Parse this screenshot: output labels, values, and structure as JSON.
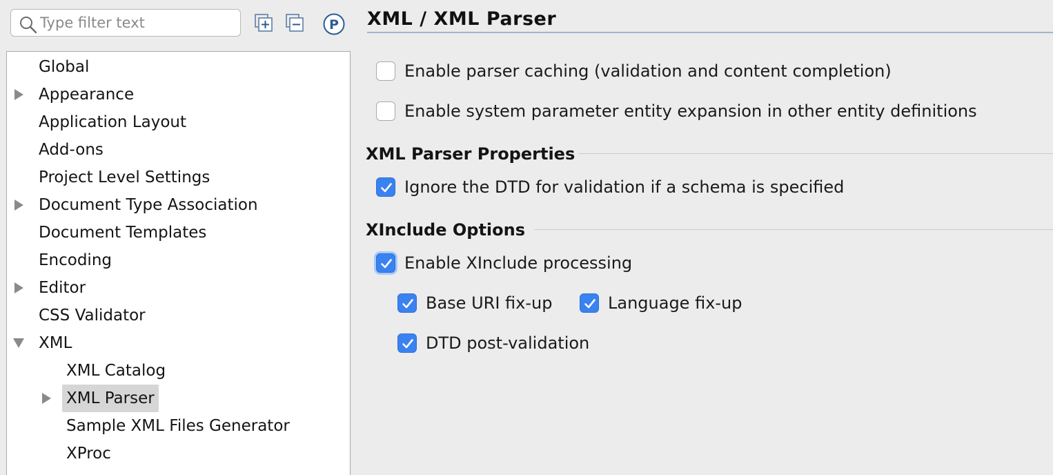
{
  "search": {
    "placeholder": "Type filter text"
  },
  "toolbar": {
    "expand_all_icon": "expand-all-icon",
    "collapse_all_icon": "collapse-all-icon",
    "project_icon": "project-options-icon",
    "project_icon_letter": "P"
  },
  "tree": {
    "items": [
      {
        "label": "Global",
        "level": 0,
        "arrow": ""
      },
      {
        "label": "Appearance",
        "level": 0,
        "arrow": "collapsed"
      },
      {
        "label": "Application Layout",
        "level": 0,
        "arrow": ""
      },
      {
        "label": "Add-ons",
        "level": 0,
        "arrow": ""
      },
      {
        "label": "Project Level Settings",
        "level": 0,
        "arrow": ""
      },
      {
        "label": "Document Type Association",
        "level": 0,
        "arrow": "collapsed"
      },
      {
        "label": "Document Templates",
        "level": 0,
        "arrow": ""
      },
      {
        "label": "Encoding",
        "level": 0,
        "arrow": ""
      },
      {
        "label": "Editor",
        "level": 0,
        "arrow": "collapsed"
      },
      {
        "label": "CSS Validator",
        "level": 0,
        "arrow": ""
      },
      {
        "label": "XML",
        "level": 0,
        "arrow": "expanded"
      },
      {
        "label": "XML Catalog",
        "level": 1,
        "arrow": ""
      },
      {
        "label": "XML Parser",
        "level": 1,
        "arrow": "collapsed",
        "selected": true
      },
      {
        "label": "Sample XML Files Generator",
        "level": 1,
        "arrow": ""
      },
      {
        "label": "XProc",
        "level": 1,
        "arrow": ""
      }
    ]
  },
  "page": {
    "title": "XML / XML Parser"
  },
  "options": {
    "parser_caching": {
      "label": "Enable parser caching (validation and content completion)",
      "checked": false
    },
    "entity_expansion": {
      "label": "Enable system parameter entity expansion in other entity definitions",
      "checked": false
    }
  },
  "parser_properties": {
    "title": "XML Parser Properties",
    "ignore_dtd": {
      "label": "Ignore the DTD for validation if a schema is specified",
      "checked": true
    }
  },
  "xinclude": {
    "title": "XInclude Options",
    "enable": {
      "label": "Enable XInclude processing",
      "checked": true
    },
    "base_uri": {
      "label": "Base URI fix-up",
      "checked": true
    },
    "language": {
      "label": "Language fix-up",
      "checked": true
    },
    "dtd_post": {
      "label": "DTD post-validation",
      "checked": true
    }
  },
  "colors": {
    "accent": "#3a82f0",
    "selection": "#d6d6d6",
    "panel_bg": "#ececec"
  }
}
